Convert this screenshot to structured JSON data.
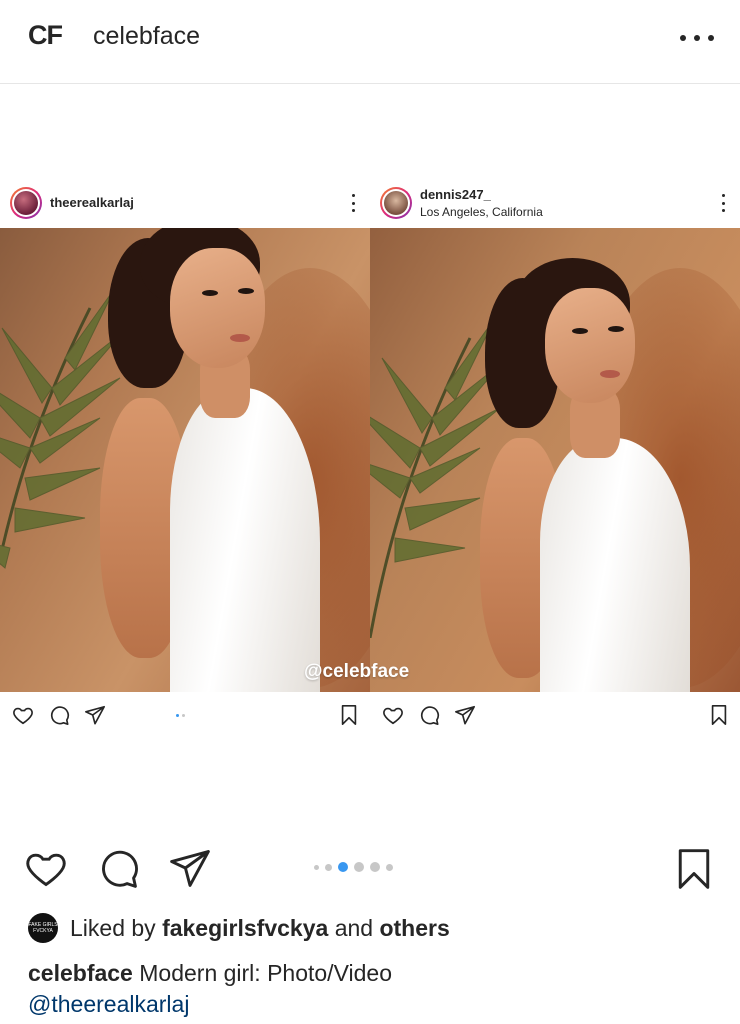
{
  "header": {
    "logo": "CF",
    "account_name": "celebface",
    "more_icon": "more-horizontal-icon"
  },
  "collage": {
    "watermark": "@celebface",
    "left_post": {
      "username": "theerealkarlaj",
      "location": "",
      "carousel_dots": 2,
      "active_dot": 0
    },
    "right_post": {
      "username": "dennis247_",
      "location": "Los Angeles, California"
    }
  },
  "actions": {
    "icons": [
      "heart-icon",
      "comment-icon",
      "share-icon",
      "bookmark-icon"
    ],
    "carousel_dot_count": 6,
    "active_dot_index": 2,
    "accent_color": "#3897f0"
  },
  "likes": {
    "prefix": "Liked by",
    "user": "fakegirlsfvckya",
    "connector": "and",
    "others": "others",
    "avatar_text": "FAKE GIRLS FVCKYA"
  },
  "caption": {
    "username": "celebface",
    "text": "Modern girl: Photo/Video",
    "mention": "@theerealkarlaj"
  }
}
